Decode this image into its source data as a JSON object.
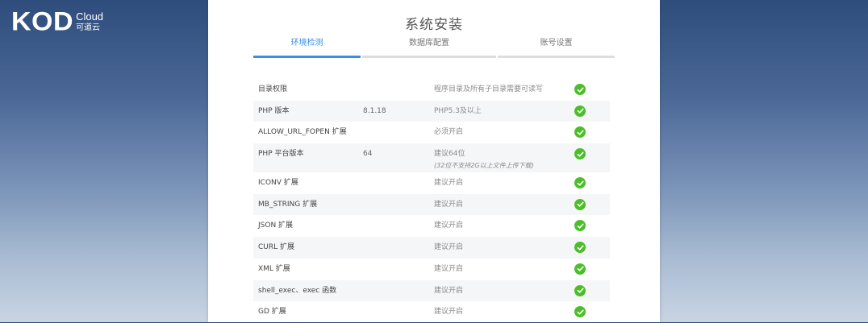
{
  "brand": {
    "mark": "KOD",
    "en": "Cloud",
    "cn": "可道云"
  },
  "title": "系统安装",
  "steps": [
    {
      "label": "环境检测",
      "active": true
    },
    {
      "label": "数据库配置",
      "active": false
    },
    {
      "label": "账号设置",
      "active": false
    }
  ],
  "checks": [
    {
      "name": "目录权限",
      "value": "",
      "requirement": "程序目录及所有子目录需要可读写",
      "note": "",
      "status": "check-icon"
    },
    {
      "name": "PHP 版本",
      "value": "8.1.18",
      "requirement": "PHP5.3及以上",
      "note": "",
      "status": "check-icon"
    },
    {
      "name": "ALLOW_URL_FOPEN 扩展",
      "value": "",
      "requirement": "必须开启",
      "note": "",
      "status": "check-icon"
    },
    {
      "name": "PHP 平台版本",
      "value": "64",
      "requirement": "建议64位",
      "note": "(32位不支持2G以上文件上传下载)",
      "status": "check-icon"
    },
    {
      "name": "ICONV 扩展",
      "value": "",
      "requirement": "建议开启",
      "note": "",
      "status": "check-icon"
    },
    {
      "name": "MB_STRING 扩展",
      "value": "",
      "requirement": "建议开启",
      "note": "",
      "status": "check-icon"
    },
    {
      "name": "JSON 扩展",
      "value": "",
      "requirement": "建议开启",
      "note": "",
      "status": "check-icon"
    },
    {
      "name": "CURL 扩展",
      "value": "",
      "requirement": "建议开启",
      "note": "",
      "status": "check-icon"
    },
    {
      "name": "XML 扩展",
      "value": "",
      "requirement": "建议开启",
      "note": "",
      "status": "check-icon"
    },
    {
      "name": "shell_exec、exec 函数",
      "value": "",
      "requirement": "建议开启",
      "note": "",
      "status": "check-icon"
    },
    {
      "name": "GD 扩展",
      "value": "",
      "requirement": "建议开启",
      "note": "",
      "status": "check-icon"
    }
  ],
  "colors": {
    "accent": "#3a8ee6",
    "ok": "#4cbe2a"
  }
}
